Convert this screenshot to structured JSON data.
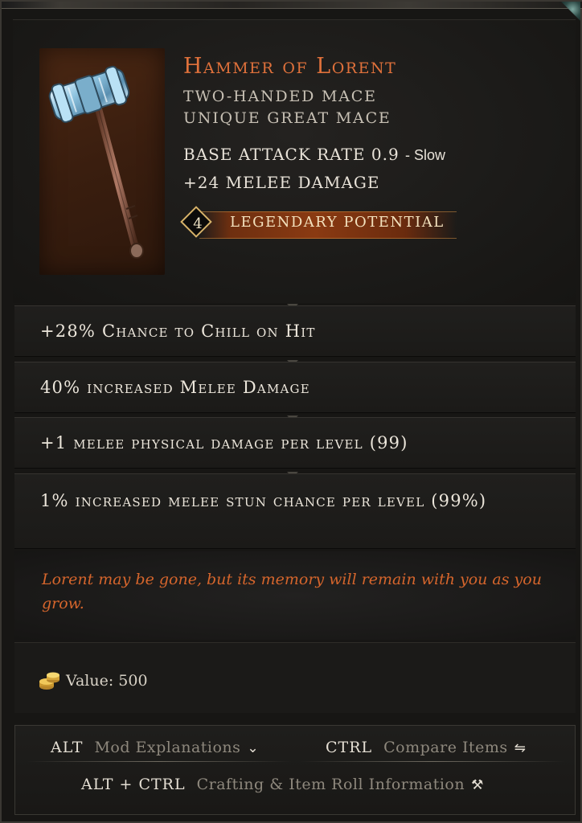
{
  "item": {
    "name": "Hammer of Lorent",
    "subtype_line1": "Two-Handed Mace",
    "subtype_line2": "Unique Great Mace",
    "base_attack_rate_label": "Base Attack Rate",
    "base_attack_rate_value": "0.9",
    "base_attack_rate_speed": "- Slow",
    "implicit": "+24 Melee Damage",
    "legendary_potential_value": "4",
    "legendary_potential_label": "Legendary Potential",
    "icon": "great-mace-icon"
  },
  "affixes": [
    "+28% Chance to Chill on Hit",
    "40% increased Melee Damage",
    "+1 melee physical damage per level (99)",
    "1% increased melee stun chance per level (99%)"
  ],
  "lore": "Lorent may be gone, but its memory will remain with you as you grow.",
  "value": {
    "label": "Value: 500",
    "icon": "gold-coins-icon"
  },
  "hints": {
    "mod_key": "ALT",
    "mod_desc": "Mod Explanations",
    "mod_icon": "chevron-down-icon",
    "compare_key": "CTRL",
    "compare_desc": "Compare Items",
    "compare_icon": "compare-arrows-icon",
    "craft_key": "ALT + CTRL",
    "craft_desc": "Crafting & Item Roll Information",
    "craft_icon": "hammer-icon"
  },
  "colors": {
    "unique_name": "#e0713b",
    "lore_text": "#d5652c",
    "legendary_bar": "#8a3a12",
    "panel_bg": "#171614"
  }
}
